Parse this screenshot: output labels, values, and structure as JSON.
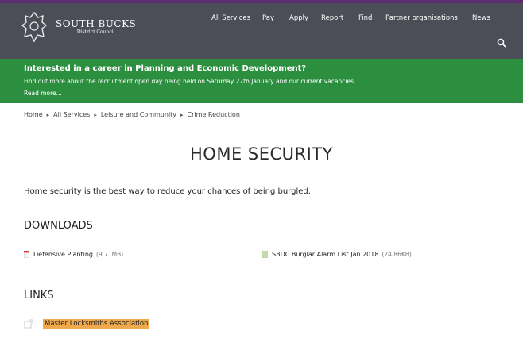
{
  "header": {
    "logo": {
      "title": "SOUTH BUCKS",
      "subtitle": "District Council"
    },
    "nav": [
      {
        "label": "All Services"
      },
      {
        "label": "Pay"
      },
      {
        "label": "Apply"
      },
      {
        "label": "Report"
      },
      {
        "label": "Find"
      },
      {
        "label": "Partner organisations"
      },
      {
        "label": "News"
      }
    ],
    "search_icon": "search-icon"
  },
  "banner": {
    "title": "Interested in a career in Planning and Economic Development?",
    "text": "Find out more about the recruitment open day being held on Saturday 27th January and our current vacancies.",
    "link": "Read more..."
  },
  "breadcrumb": [
    "Home",
    "All Services",
    "Leisure and Community",
    "Crime Reduction"
  ],
  "page": {
    "title": "HOME SECURITY",
    "intro": "Home security is the best way to reduce your chances of being burgled."
  },
  "downloads": {
    "heading": "DOWNLOADS",
    "items": [
      {
        "name": "Defensive Planting",
        "meta": "(9.71MB)",
        "icon": "pdf-icon"
      },
      {
        "name": "SBDC Burglar Alarm List Jan 2018",
        "meta": "(24.86KB)",
        "icon": "spreadsheet-icon"
      }
    ]
  },
  "links": {
    "heading": "LINKS",
    "items": [
      {
        "label": "Master Locksmiths Association",
        "icon": "external-link-icon"
      }
    ]
  },
  "colors": {
    "header": "#4b4e57",
    "accent_bar": "#5b2d6e",
    "banner": "#2c8e3f",
    "link_highlight": "#f0a94d"
  }
}
